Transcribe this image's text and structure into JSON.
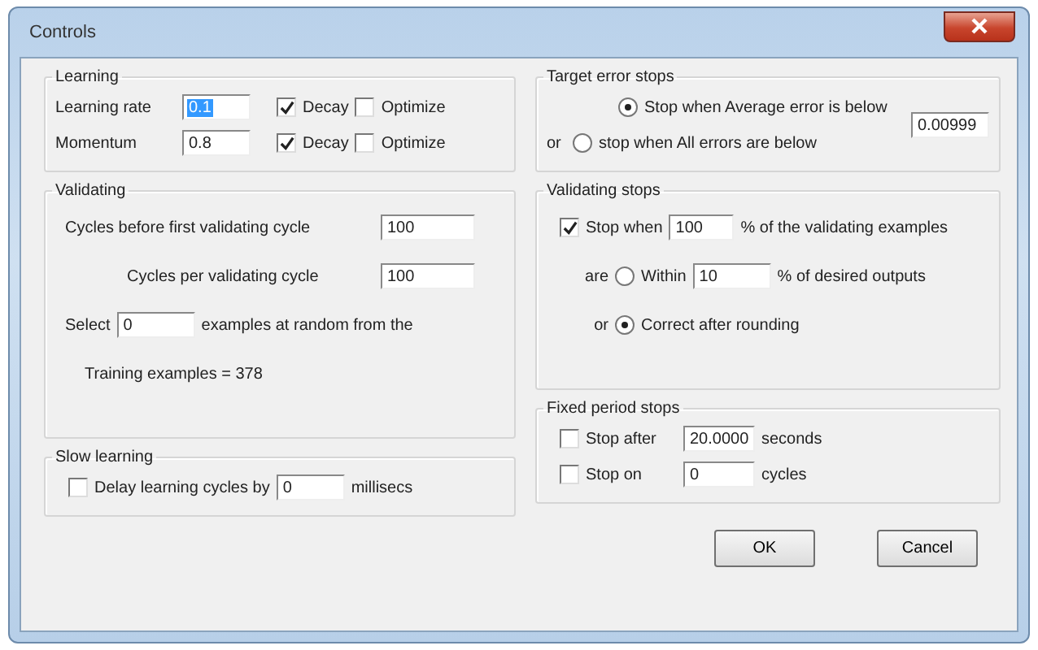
{
  "window": {
    "title": "Controls"
  },
  "learning": {
    "title": "Learning",
    "rows": [
      {
        "label": "Learning rate",
        "value": "0.1",
        "value_selected": true,
        "decay": {
          "label": "Decay",
          "checked": true
        },
        "optimize": {
          "label": "Optimize",
          "checked": false
        }
      },
      {
        "label": "Momentum",
        "value": "0.8",
        "value_selected": false,
        "decay": {
          "label": "Decay",
          "checked": true
        },
        "optimize": {
          "label": "Optimize",
          "checked": false
        }
      }
    ]
  },
  "validating": {
    "title": "Validating",
    "first_cycle": {
      "label": "Cycles before first validating cycle",
      "value": "100"
    },
    "per_cycle": {
      "label": "Cycles per validating cycle",
      "value": "100"
    },
    "select": {
      "label": "Select",
      "value": "0",
      "suffix": "examples at random from the"
    },
    "training": "Training examples = 378"
  },
  "slow_learning": {
    "title": "Slow learning",
    "delay": {
      "label": "Delay learning cycles by",
      "checked": false,
      "value": "0",
      "unit": "millisecs"
    }
  },
  "target_error": {
    "title": "Target error stops",
    "options": [
      {
        "label": "Stop when Average error is below",
        "selected": true
      },
      {
        "prefix": "or",
        "label": "stop when All errors are below",
        "selected": false
      }
    ],
    "value": "0.00999"
  },
  "validating_stops": {
    "title": "Validating stops",
    "stop_when": {
      "label": "Stop when",
      "checked": true,
      "value": "100",
      "suffix": "% of the validating examples"
    },
    "criteria": [
      {
        "prefix": "are",
        "label": "Within",
        "selected": false,
        "value": "10",
        "suffix": "% of desired outputs"
      },
      {
        "prefix": "or",
        "label": "Correct after rounding",
        "selected": true
      }
    ]
  },
  "fixed_period": {
    "title": "Fixed period stops",
    "rows": [
      {
        "label": "Stop after",
        "checked": false,
        "value": "20.0000",
        "unit": "seconds"
      },
      {
        "label": "Stop on",
        "checked": false,
        "value": "0",
        "unit": "cycles"
      }
    ]
  },
  "buttons": [
    "OK",
    "Cancel"
  ]
}
